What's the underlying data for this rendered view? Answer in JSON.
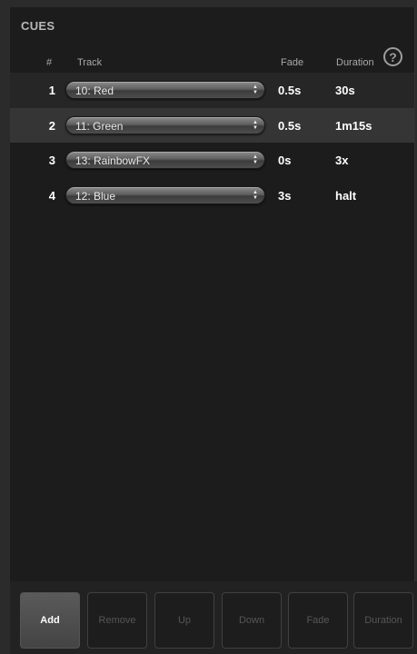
{
  "section_title": "CUES",
  "headers": {
    "num": "#",
    "track": "Track",
    "fade": "Fade",
    "duration": "Duration"
  },
  "help_icon": "question-mark-circle-icon",
  "cues": [
    {
      "num": "1",
      "track": "10: Red",
      "fade": "0.5s",
      "duration": "30s"
    },
    {
      "num": "2",
      "track": "11: Green",
      "fade": "0.5s",
      "duration": "1m15s"
    },
    {
      "num": "3",
      "track": "13: RainbowFX",
      "fade": "0s",
      "duration": "3x"
    },
    {
      "num": "4",
      "track": "12: Blue",
      "fade": "3s",
      "duration": "halt"
    }
  ],
  "selected_row": 2,
  "toolbar": {
    "add": "Add",
    "remove": "Remove",
    "up": "Up",
    "down": "Down",
    "fade": "Fade",
    "duration": "Duration"
  },
  "colors": {
    "background": "#1c1c1c",
    "selected_row": "#353535",
    "text": "#ffffff",
    "disabled_text": "#565656"
  }
}
